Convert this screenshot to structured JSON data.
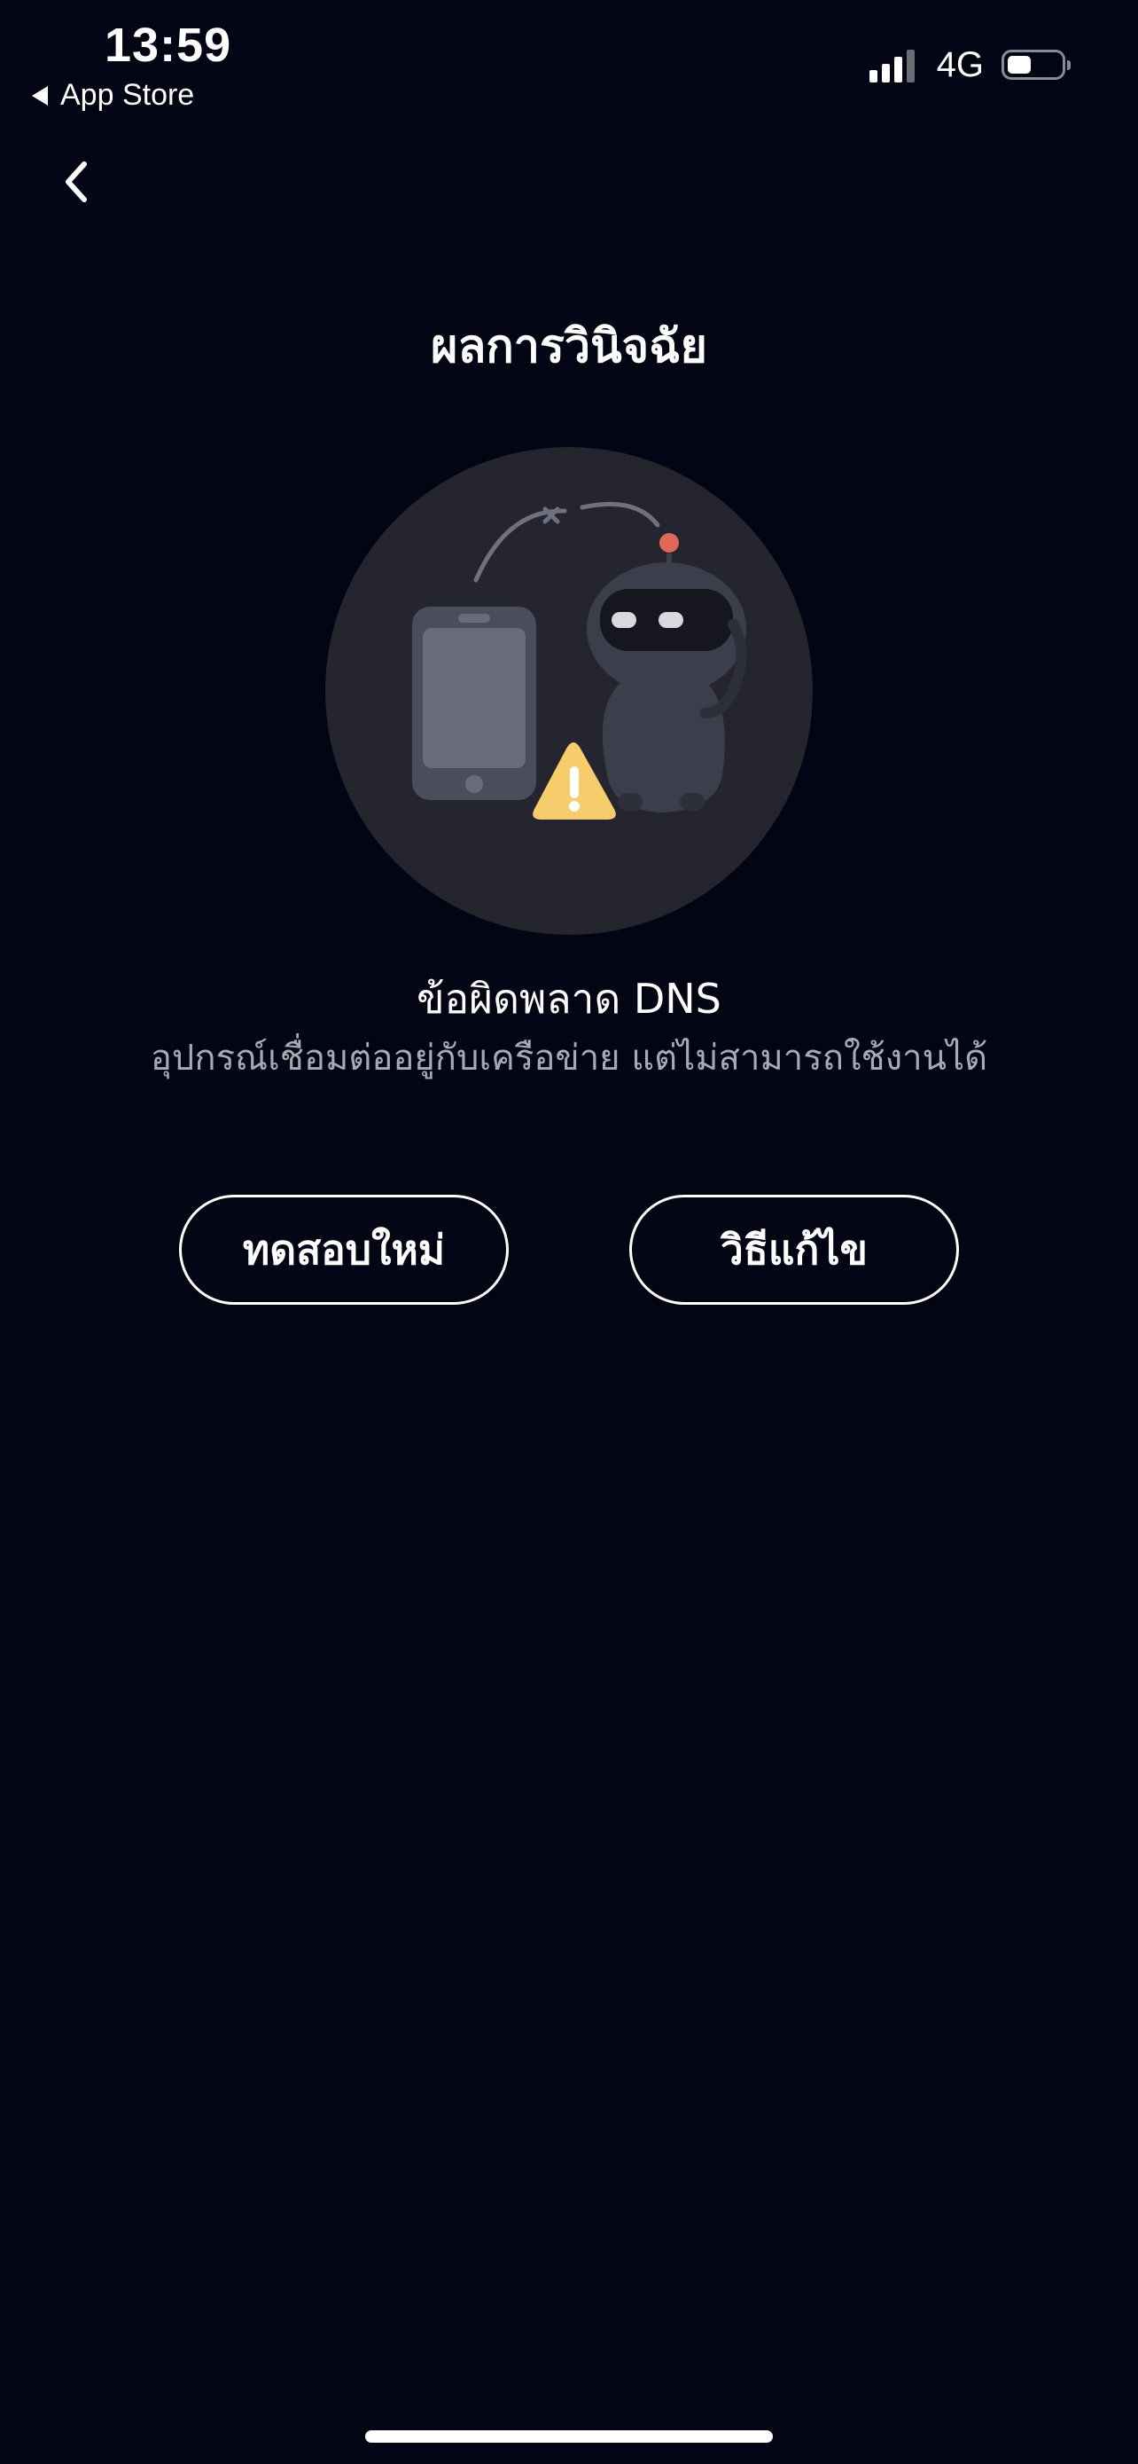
{
  "status_bar": {
    "time": "13:59",
    "back_app": "App Store",
    "network": "4G",
    "signal_bars": 3,
    "battery_level": 0.45
  },
  "header": {
    "title": "ผลการวินิจฉัย",
    "back_icon": "chevron-left-icon"
  },
  "illustration": {
    "icons": [
      "phone-icon",
      "robot-icon",
      "warning-icon"
    ],
    "colors": {
      "circle": "#24252e",
      "warning": "#f7cd6b",
      "robot_antenna": "#e0685a"
    }
  },
  "result": {
    "title": "ข้อผิดพลาด DNS",
    "description": "อุปกรณ์เชื่อมต่ออยู่กับเครือข่าย แต่ไม่สามารถใช้งานได้"
  },
  "actions": {
    "retry_label": "ทดสอบใหม่",
    "fix_label": "วิธีแก้ไข"
  },
  "colors": {
    "background": "#030414",
    "text": "#ffffff",
    "muted_text": "#a7a9b4"
  }
}
